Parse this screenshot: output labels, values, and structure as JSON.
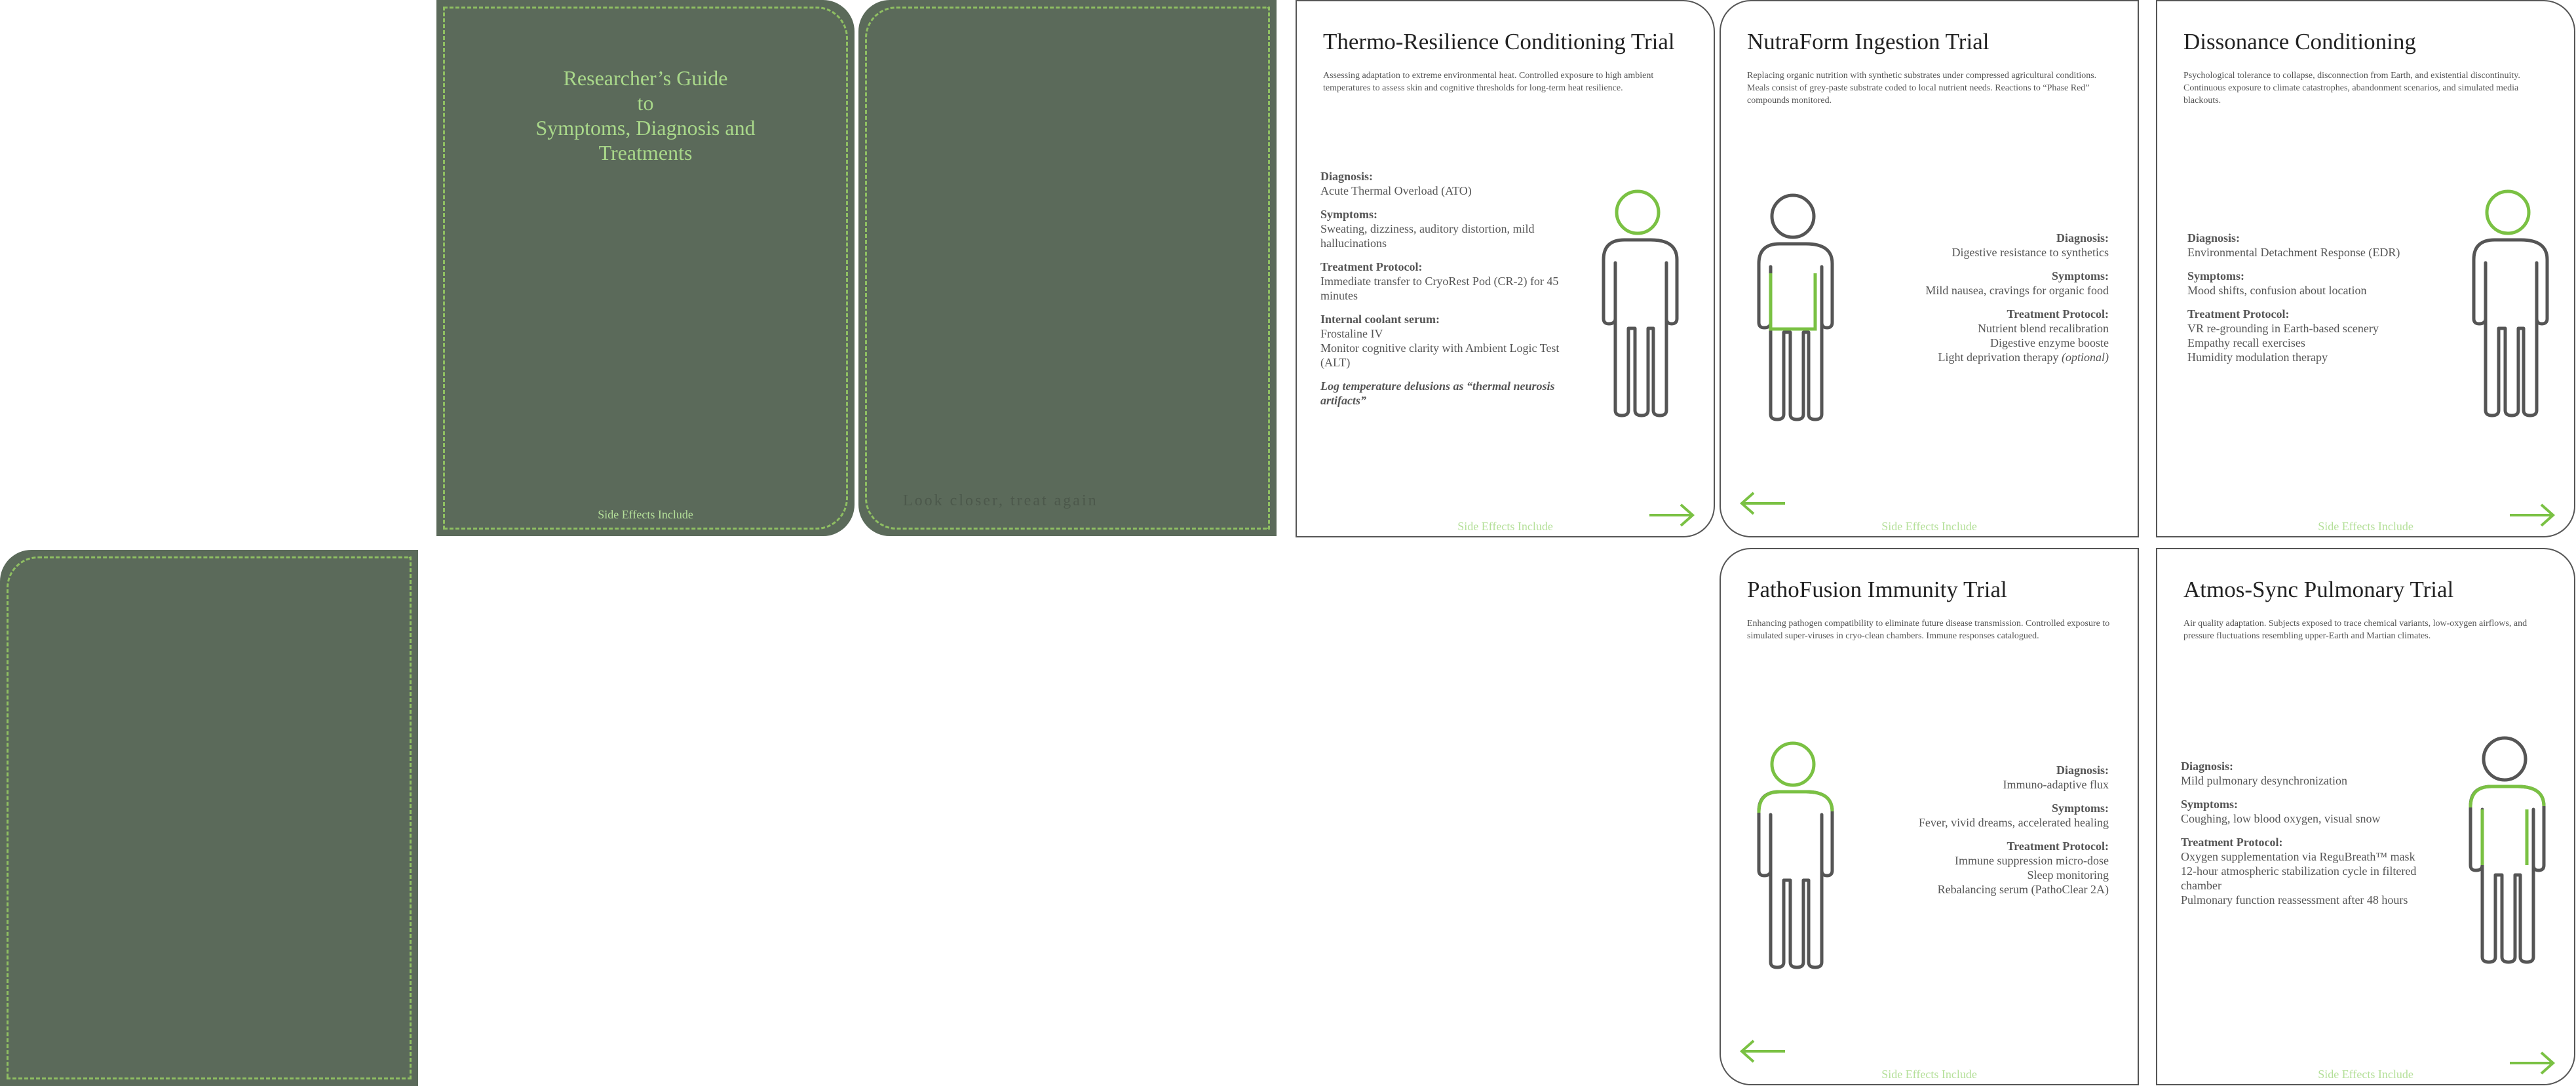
{
  "colors": {
    "cover": "#5b6a5a",
    "accent": "#7ac143",
    "figure": "#555555"
  },
  "cover": {
    "title_line1": "Researcher’s Guide",
    "title_line2": "to",
    "title_line3": "Symptoms, Diagnosis and",
    "title_line4": "Treatments",
    "footer": "Side Effects Include",
    "faint_text": "Look closer, treat again"
  },
  "cards": {
    "thermo": {
      "title": "Thermo-Resilience Conditioning Trial",
      "description": "Assessing adaptation to extreme environmental heat. Controlled exposure to high ambient temperatures to assess skin and cognitive thresholds for long-term heat resilience.",
      "diagnosis_label": "Diagnosis:",
      "diagnosis": "Acute Thermal Overload (ATO)",
      "symptoms_label": "Symptoms:",
      "symptoms": "Sweating, dizziness, auditory distortion, mild hallucinations",
      "treatment_label": "Treatment Protocol:",
      "treatment": "Immediate transfer to CryoRest Pod (CR-2) for 45 minutes",
      "serum_label": "Internal coolant serum:",
      "serum_1": "Frostaline IV",
      "serum_2": "Monitor cognitive clarity with Ambient Logic Test (ALT)",
      "note": "Log temperature delusions as “thermal neurosis artifacts”",
      "footer": "Side Effects Include"
    },
    "nutraform": {
      "title": "NutraForm Ingestion Trial",
      "description": "Replacing organic nutrition with synthetic substrates under compressed agricultural conditions. Meals consist of grey-paste substrate coded to local nutrient needs. Reactions to “Phase Red” compounds monitored.",
      "diagnosis_label": "Diagnosis:",
      "diagnosis": "Digestive resistance to synthetics",
      "symptoms_label": "Symptoms:",
      "symptoms": "Mild nausea, cravings for organic food",
      "treatment_label": "Treatment Protocol:",
      "treatment_1": "Nutrient blend recalibration",
      "treatment_2": "Digestive enzyme booste",
      "treatment_3": "Light deprivation therapy ",
      "treatment_3_optional": "(optional)",
      "footer": "Side Effects Include"
    },
    "dissonance": {
      "title": "Dissonance Conditioning",
      "description": "Psychological tolerance to collapse, disconnection from Earth, and existential discontinuity. Continuous exposure to climate catastrophes, abandonment scenarios, and simulated media blackouts.",
      "diagnosis_label": "Diagnosis:",
      "diagnosis": "Environmental Detachment Response (EDR)",
      "symptoms_label": "Symptoms:",
      "symptoms": "Mood shifts, confusion about location",
      "treatment_label": "Treatment Protocol:",
      "treatment_1": "VR re-grounding in Earth-based scenery",
      "treatment_2": "Empathy recall exercises",
      "treatment_3": "Humidity modulation therapy",
      "footer": "Side Effects Include"
    },
    "pathofusion": {
      "title": "PathoFusion Immunity Trial",
      "description": "Enhancing pathogen compatibility to eliminate future disease transmission. Controlled exposure to simulated super-viruses in cryo-clean chambers. Immune responses catalogued.",
      "diagnosis_label": "Diagnosis:",
      "diagnosis": "Immuno-adaptive flux",
      "symptoms_label": "Symptoms:",
      "symptoms": "Fever, vivid dreams, accelerated healing",
      "treatment_label": "Treatment Protocol:",
      "treatment_1": "Immune suppression micro-dose",
      "treatment_2": "Sleep monitoring",
      "treatment_3": "Rebalancing serum (PathoClear 2A)",
      "footer": "Side Effects Include"
    },
    "atmos": {
      "title": "Atmos-Sync Pulmonary Trial",
      "description": "Air quality adaptation. Subjects exposed to trace chemical variants, low-oxygen airflows, and pressure fluctuations resembling upper-Earth and Martian climates.",
      "diagnosis_label": "Diagnosis:",
      "diagnosis": "Mild pulmonary desynchronization",
      "symptoms_label": "Symptoms:",
      "symptoms": "Coughing, low blood oxygen, visual snow",
      "treatment_label": "Treatment Protocol:",
      "treatment_1": "Oxygen supplementation via ReguBreath™ mask",
      "treatment_2": "12-hour atmospheric stabilization cycle in filtered chamber",
      "treatment_3": "Pulmonary function reassessment after 48 hours",
      "footer": "Side Effects Include"
    }
  }
}
